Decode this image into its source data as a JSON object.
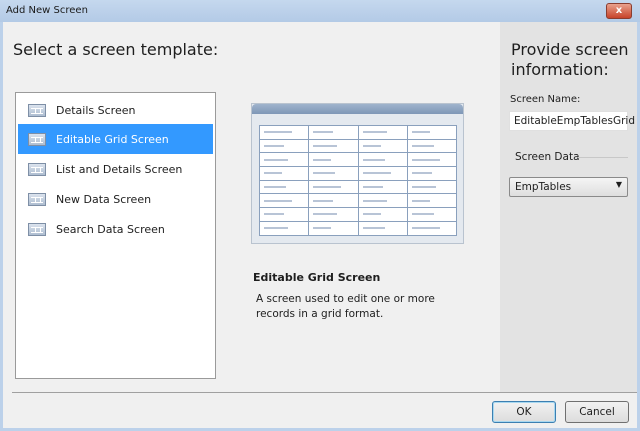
{
  "window": {
    "title": "Add New Screen",
    "close_label": "x"
  },
  "left": {
    "heading": "Select a screen template:",
    "templates": [
      {
        "label": "Details Screen"
      },
      {
        "label": "Editable Grid Screen",
        "selected": true
      },
      {
        "label": "List and Details Screen"
      },
      {
        "label": "New Data Screen"
      },
      {
        "label": "Search Data Screen"
      }
    ]
  },
  "preview": {
    "title": "Editable Grid Screen",
    "description": "A screen used to edit one or more records in a grid format."
  },
  "right": {
    "heading": "Provide screen information:",
    "screen_name_label": "Screen Name:",
    "screen_name_value": "EditableEmpTablesGrid",
    "screen_data_label": "Screen Data",
    "screen_data_value": "EmpTables"
  },
  "buttons": {
    "ok": "OK",
    "cancel": "Cancel"
  }
}
